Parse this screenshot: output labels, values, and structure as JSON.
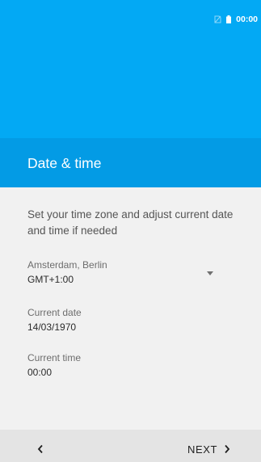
{
  "status_bar": {
    "time": "00:00",
    "icons": [
      "no-sim-icon",
      "battery-icon"
    ]
  },
  "header": {
    "title": "Date & time"
  },
  "main": {
    "description": "Set your time zone and adjust current date and time if needed",
    "timezone": {
      "label": "Amsterdam, Berlin",
      "value": "GMT+1:00",
      "icon": "dropdown-arrow-icon"
    },
    "current_date": {
      "label": "Current date",
      "value": "14/03/1970"
    },
    "current_time": {
      "label": "Current time",
      "value": "00:00"
    }
  },
  "nav": {
    "back_icon": "chevron-left-icon",
    "next_label": "NEXT",
    "next_icon": "chevron-right-icon"
  },
  "colors": {
    "accent": "#03a9f4",
    "accent_dark": "#039be5",
    "background": "#f1f1f1",
    "nav_background": "#e4e4e4"
  }
}
